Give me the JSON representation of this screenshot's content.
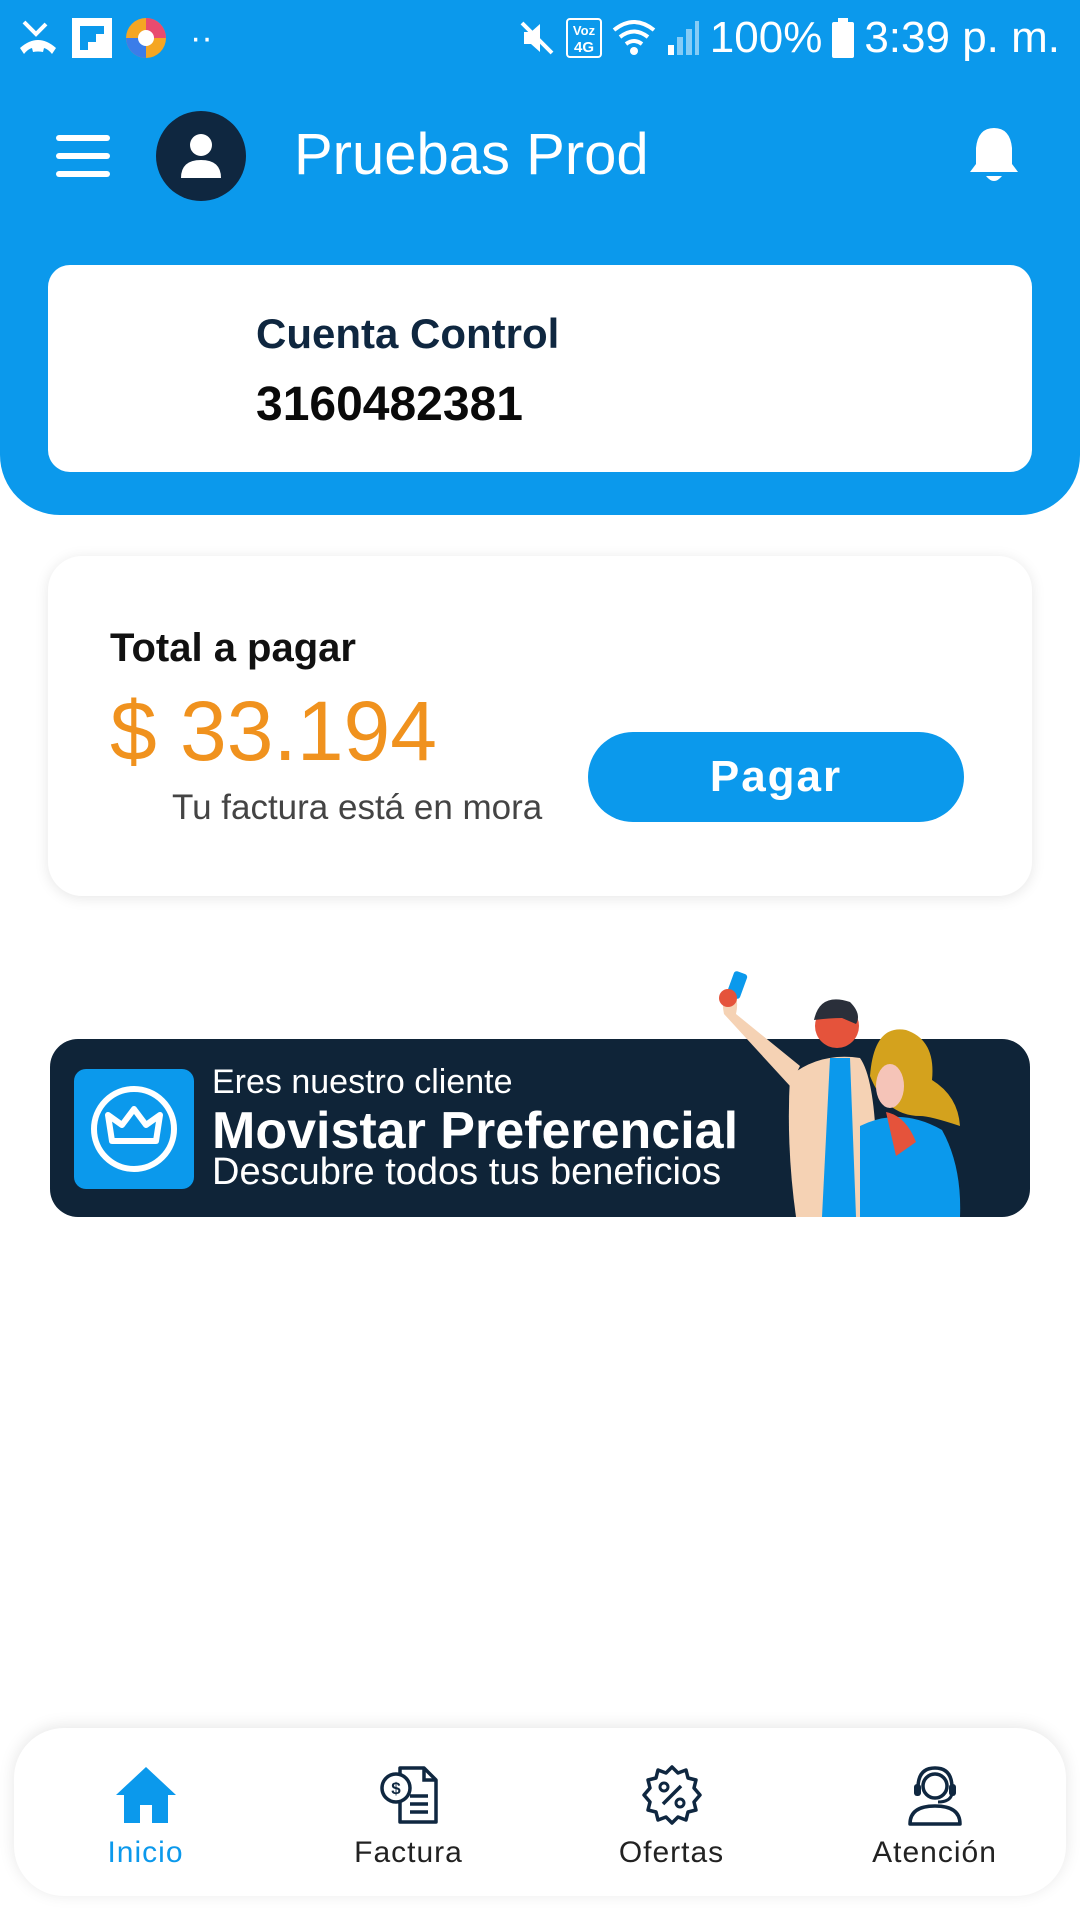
{
  "status_bar": {
    "battery": "100%",
    "time": "3:39 p. m.",
    "network_badge": "Voz 4G",
    "dots": "··"
  },
  "app_bar": {
    "title": "Pruebas Prod"
  },
  "account": {
    "type": "Cuenta Control",
    "number": "3160482381"
  },
  "payment": {
    "label": "Total a pagar",
    "amount": "$ 33.194",
    "status": "Tu factura está en mora",
    "button_label": "Pagar"
  },
  "banner": {
    "line1": "Eres nuestro cliente",
    "line2": "Movistar Preferencial",
    "line3": "Descubre todos tus beneficios"
  },
  "bottom_nav": {
    "items": [
      {
        "label": "Inicio",
        "icon": "home-icon",
        "active": true
      },
      {
        "label": "Factura",
        "icon": "invoice-icon",
        "active": false
      },
      {
        "label": "Ofertas",
        "icon": "discount-icon",
        "active": false
      },
      {
        "label": "Atención",
        "icon": "support-agent-icon",
        "active": false
      }
    ]
  },
  "colors": {
    "primary": "#0b99ec",
    "dark": "#0f2740",
    "amount": "#f0921e"
  }
}
